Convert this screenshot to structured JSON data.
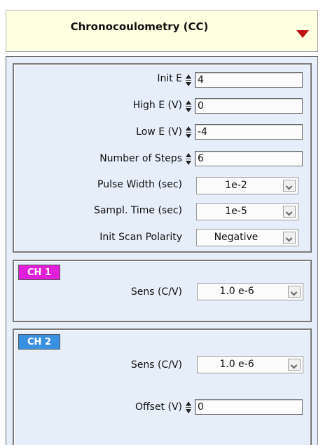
{
  "technique": {
    "label": "Chronocoulometry (CC)",
    "arrow_icon": "triangle-down-red",
    "bg_color": "#ffffe1"
  },
  "params": {
    "init_e": {
      "label": "Init E",
      "value": "4"
    },
    "high_e": {
      "label": "High E (V)",
      "value": "0"
    },
    "low_e": {
      "label": "Low E (V)",
      "value": "-4"
    },
    "num_steps": {
      "label": "Number of Steps",
      "value": "6"
    },
    "pulse_width": {
      "label": "Pulse Width (sec)",
      "value": "1e-2"
    },
    "sample_time": {
      "label": "Sampl. Time (sec)",
      "value": "1e-5"
    },
    "init_scan_polarity": {
      "label": "Init Scan Polarity",
      "value": "Negative"
    }
  },
  "ch1": {
    "tab": "CH 1",
    "tab_color": "#e020d8",
    "sens": {
      "label": "Sens (C/V)",
      "value": "1.0 e-6"
    }
  },
  "ch2": {
    "tab": "CH 2",
    "tab_color": "#3a90e0",
    "sens": {
      "label": "Sens (C/V)",
      "value": "1.0 e-6"
    },
    "offset": {
      "label": "Offset (V)",
      "value": "0"
    }
  }
}
